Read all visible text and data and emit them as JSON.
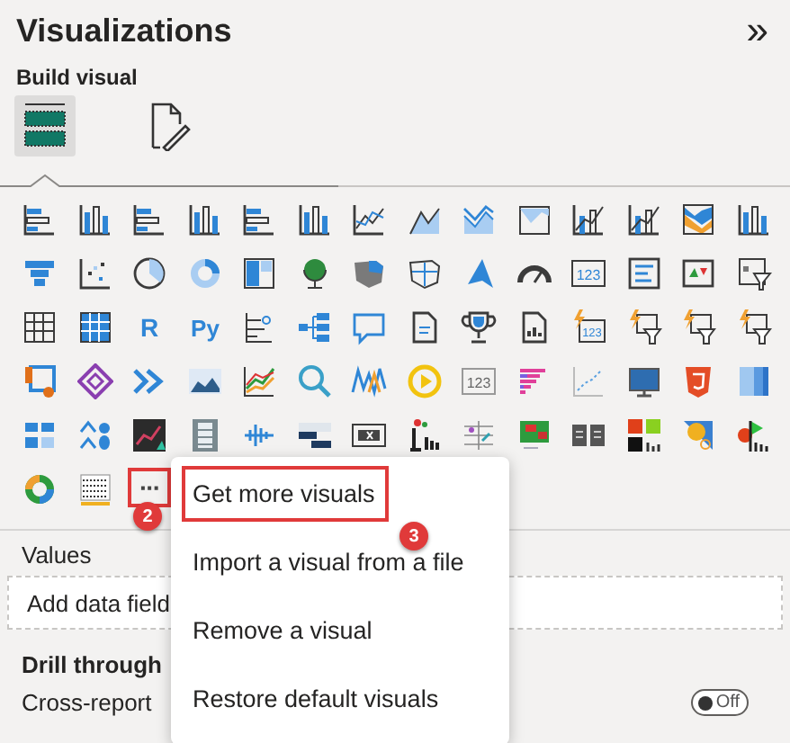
{
  "panel": {
    "title": "Visualizations",
    "collapse_glyph": "»"
  },
  "build_visual": {
    "heading": "Build visual",
    "view_tabs": [
      {
        "kind": "build",
        "selected": true
      },
      {
        "kind": "format",
        "selected": false
      }
    ]
  },
  "visual_icon_labels": [
    "123",
    "R",
    "Py",
    "123",
    "123"
  ],
  "more_button": {
    "label": "···",
    "highlighted": true
  },
  "menu": {
    "items": [
      {
        "label": "Get more visuals",
        "highlighted": true
      },
      {
        "label": "Import a visual from a file",
        "highlighted": false
      },
      {
        "label": "Remove a visual",
        "highlighted": false
      },
      {
        "label": "Restore default visuals",
        "highlighted": false
      }
    ]
  },
  "callouts": [
    "2",
    "3"
  ],
  "values": {
    "heading": "Values",
    "hint": "Add data field"
  },
  "drill_through": {
    "heading": "Drill through",
    "cross_report": {
      "label": "Cross-report",
      "on": false,
      "state_text": "Off"
    }
  }
}
